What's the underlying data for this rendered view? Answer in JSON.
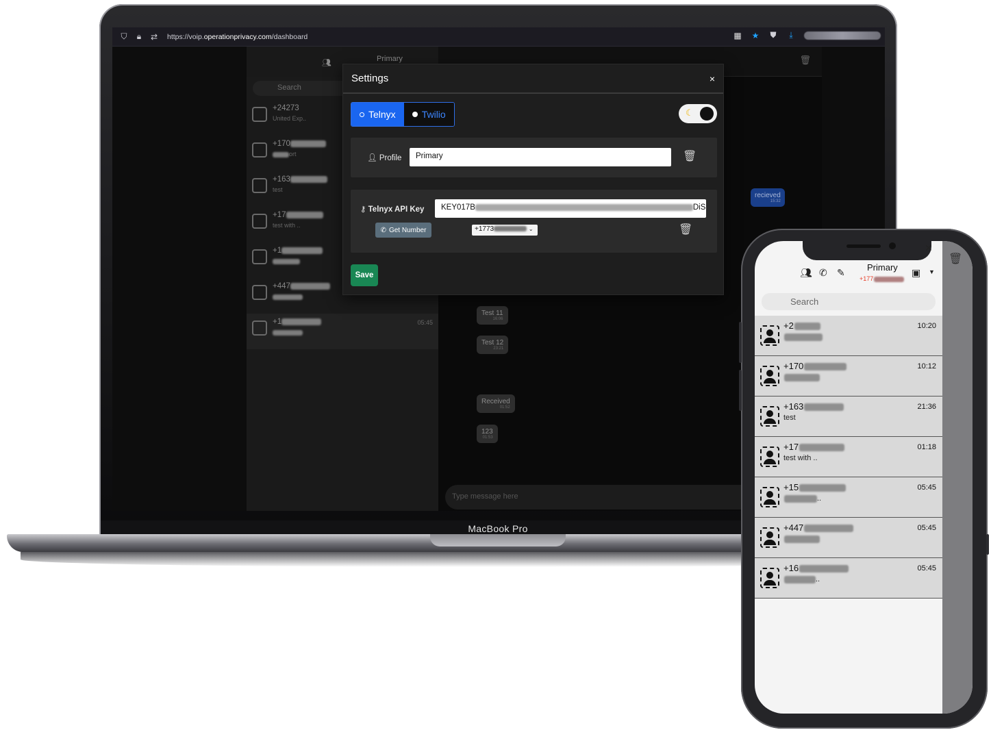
{
  "device_label": "MacBook Pro",
  "browser": {
    "url_prefix": "https://voip.",
    "url_domain": "operationprivacy.com",
    "url_path": "/dashboard"
  },
  "settings_modal": {
    "title": "Settings",
    "close_label": "×",
    "tabs": [
      {
        "label": "Telnyx",
        "active": true
      },
      {
        "label": "Twilio",
        "active": false
      }
    ],
    "profile_label": "Profile",
    "profile_value": "Primary",
    "api_key_label": "Telnyx API Key",
    "api_key_value_start": "KEY017B",
    "api_key_value_end": "DiS",
    "get_number_label": "Get Number",
    "number_prefix": "+1773",
    "save_label": "Save"
  },
  "desktop_app": {
    "search_placeholder": "Search",
    "profile_name": "Primary",
    "contacts": [
      {
        "number": "+24273",
        "subtitle": "United Exp..",
        "time": ""
      },
      {
        "number": "+170",
        "subtitle": "ort",
        "time": ""
      },
      {
        "number": "+163",
        "subtitle": "test",
        "time": ""
      },
      {
        "number": "+17",
        "subtitle": "test with ..",
        "time": ""
      },
      {
        "number": "+1",
        "subtitle": "",
        "time": ""
      },
      {
        "number": "+447",
        "subtitle": "",
        "time": ""
      },
      {
        "number": "+1",
        "subtitle": "",
        "time": "05:45"
      }
    ],
    "messages": [
      {
        "text": "recieved",
        "time": "15:32",
        "incoming": false
      },
      {
        "text": "Test 11",
        "time": "16:06",
        "incoming": true
      },
      {
        "text": "Test 12",
        "time": "23:21",
        "incoming": true
      },
      {
        "text": "Received",
        "time": "01:52",
        "incoming": true
      },
      {
        "text": "123",
        "time": "01:53",
        "incoming": true
      }
    ],
    "message_placeholder": "Type message here"
  },
  "phone_app": {
    "profile_name": "Primary",
    "profile_number": "+177",
    "search_placeholder": "Search",
    "contacts": [
      {
        "number": "+2",
        "subtitle": "",
        "time": "10:20"
      },
      {
        "number": "+170",
        "subtitle": "",
        "time": "10:12"
      },
      {
        "number": "+163",
        "subtitle": "test",
        "time": "21:36"
      },
      {
        "number": "+17",
        "subtitle": "test with ..",
        "time": "01:18"
      },
      {
        "number": "+15",
        "subtitle": "..",
        "time": "05:45"
      },
      {
        "number": "+447",
        "subtitle": "",
        "time": "05:45"
      },
      {
        "number": "+16",
        "subtitle": "..",
        "time": "05:45"
      }
    ]
  },
  "colors": {
    "accent_blue": "#1a66f0",
    "save_green": "#198754",
    "phone_number_red": "#e8412c",
    "sent_bubble": "#1a3f8a"
  },
  "icons": [
    "shield-icon",
    "lock-icon",
    "permissions-icon",
    "qr-icon",
    "star-icon",
    "pocket-icon",
    "download-icon",
    "contacts-icon",
    "phone-icon",
    "edit-icon",
    "trash-icon",
    "user-icon",
    "key-icon",
    "moon-icon",
    "chevron-down-icon",
    "close-icon"
  ]
}
